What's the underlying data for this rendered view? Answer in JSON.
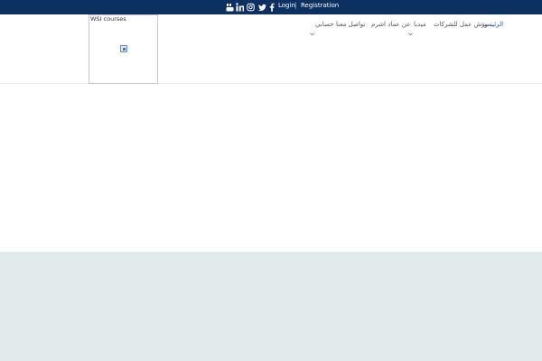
{
  "topbar": {
    "social_icons": [
      "youtube-icon",
      "linkedin-icon",
      "instagram-icon",
      "twitter-icon",
      "facebook-icon"
    ],
    "login_label": "Login",
    "separator": "|",
    "registration_label": "Registration"
  },
  "logo": {
    "alt_text": "WSI courses"
  },
  "nav": {
    "items": [
      {
        "label": "الرئيسية",
        "active": true,
        "has_dropdown": false
      },
      {
        "label": "ورش عمل للشركات",
        "active": false,
        "has_dropdown": false
      },
      {
        "label": "ميديا",
        "active": false,
        "has_dropdown": true
      },
      {
        "label": "عن عماد اشرم",
        "active": false,
        "has_dropdown": false
      },
      {
        "label": "تواصل معنا",
        "active": false,
        "has_dropdown": false
      },
      {
        "label": "حسابي",
        "active": false,
        "has_dropdown": true
      }
    ]
  },
  "colors": {
    "topbar": "#0c3160",
    "nav_active": "#1a58a7",
    "nav_text": "#555555",
    "footer_band": "#e2ebeb"
  }
}
